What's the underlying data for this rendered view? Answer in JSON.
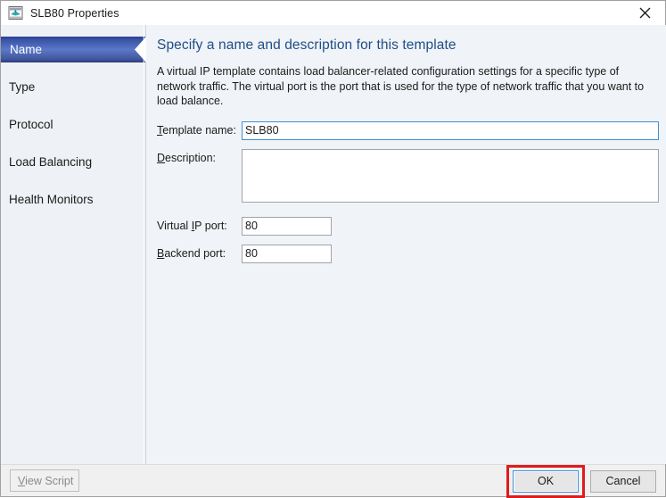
{
  "window": {
    "title": "SLB80 Properties",
    "icon": "template-properties-icon",
    "close_icon": "close-icon"
  },
  "sidebar": {
    "items": [
      {
        "label": "Name",
        "selected": true
      },
      {
        "label": "Type",
        "selected": false
      },
      {
        "label": "Protocol",
        "selected": false
      },
      {
        "label": "Load Balancing",
        "selected": false
      },
      {
        "label": "Health Monitors",
        "selected": false
      }
    ]
  },
  "content": {
    "heading": "Specify a name and description for this template",
    "description": "A virtual IP template contains load balancer-related configuration settings for a specific type of network traffic. The virtual port is the port that is used for the type of network traffic that you want to load balance.",
    "fields": {
      "template_name": {
        "label_prefix": "",
        "label_accel": "T",
        "label_suffix": "emplate name:",
        "value": "SLB80",
        "focused": true
      },
      "description": {
        "label_prefix": "",
        "label_accel": "D",
        "label_suffix": "escription:",
        "value": "",
        "focused": false
      },
      "virtual_ip_port": {
        "label_prefix": "Virtual ",
        "label_accel": "I",
        "label_suffix": "P port:",
        "value": "80",
        "focused": false
      },
      "backend_port": {
        "label_prefix": "",
        "label_accel": "B",
        "label_suffix": "ackend port:",
        "value": "80",
        "focused": false
      }
    }
  },
  "footer": {
    "view_script": {
      "label_accel": "V",
      "label_suffix": "iew Script",
      "disabled": true
    },
    "ok_label": "OK",
    "cancel_label": "Cancel"
  },
  "colors": {
    "heading": "#1f4e87",
    "selected_nav": "#3b55a8",
    "focus_border": "#3d91d8",
    "annotation": "#e01b1b",
    "content_bg": "#f0f3f7",
    "sidebar_bg": "#eef1f5"
  }
}
